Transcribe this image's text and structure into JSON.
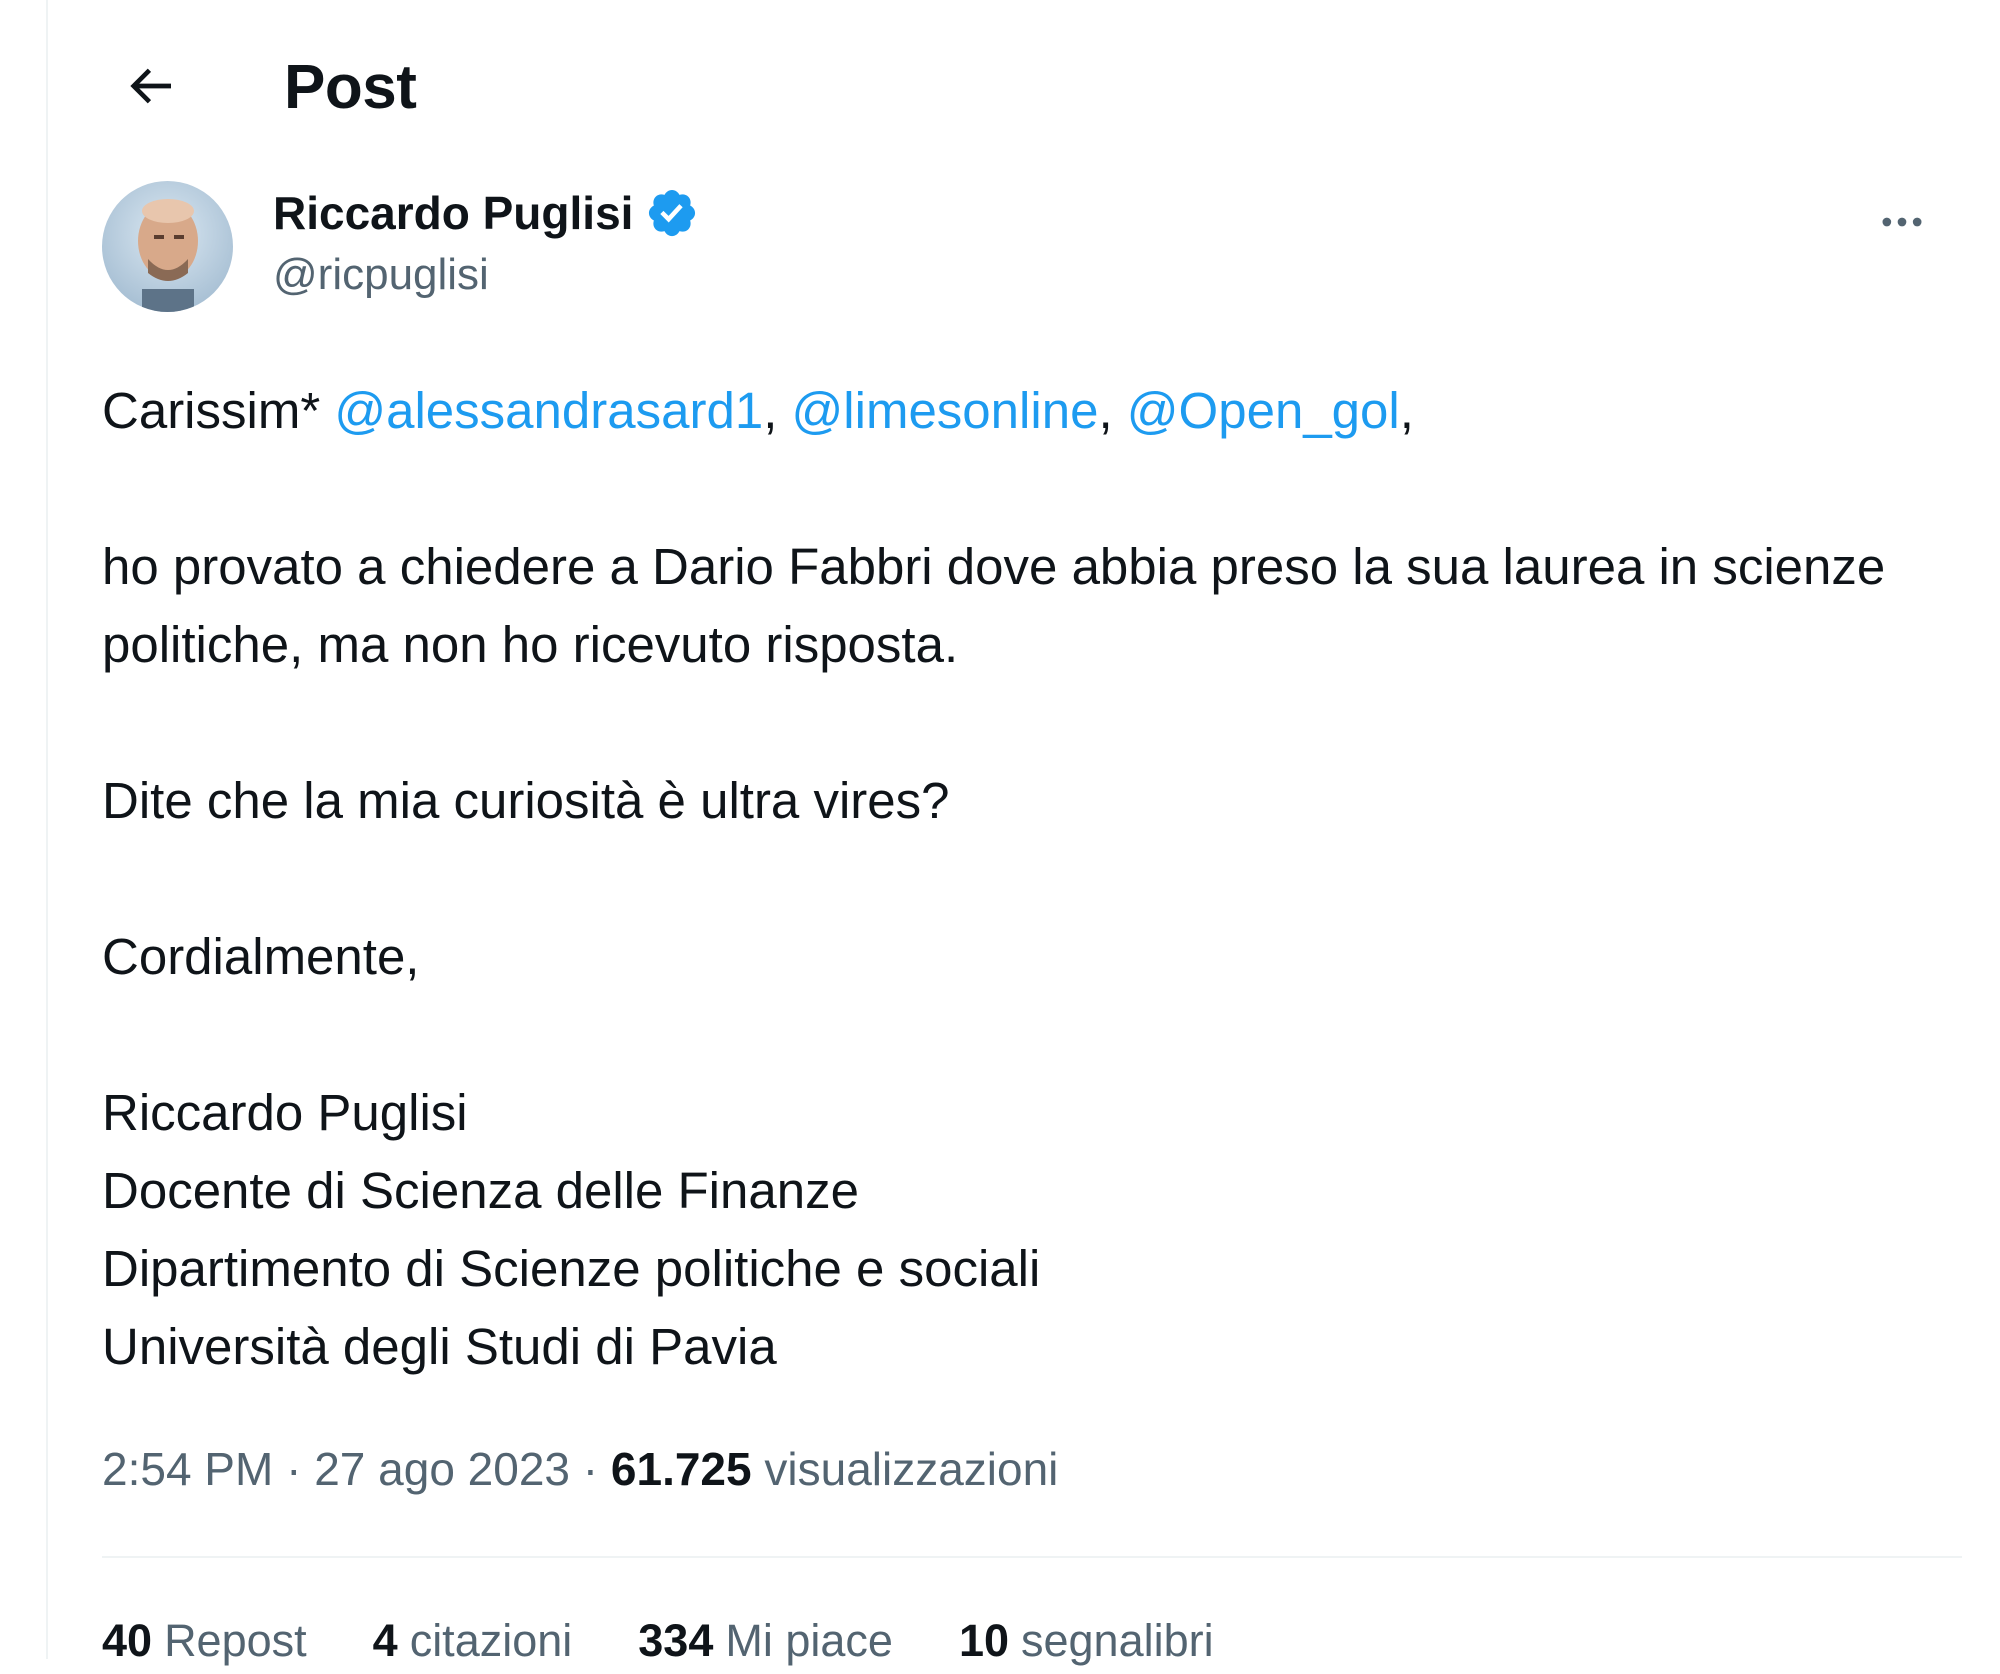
{
  "header": {
    "title": "Post",
    "back_icon": "arrow-left-icon"
  },
  "author": {
    "name": "Riccardo Puglisi",
    "handle": "@ricpuglisi",
    "verified": true,
    "verified_color": "#1d9bf0"
  },
  "tweet": {
    "greeting_prefix": "Carissim* ",
    "mentions": [
      "@alessandrasard1",
      "@limesonline",
      "@Open_gol"
    ],
    "separator": ", ",
    "greeting_suffix": ",",
    "paragraph_1": "ho provato a chiedere a Dario Fabbri dove abbia preso la sua laurea in scienze politiche, ma non ho ricevuto risposta.",
    "paragraph_2": "Dite che la mia curiosità è ultra vires?",
    "closing": "Cordialmente,",
    "signature": [
      "Riccardo Puglisi",
      "Docente di Scienza delle Finanze",
      "Dipartimento di Scienze politiche e sociali",
      "Università degli Studi di Pavia"
    ]
  },
  "meta": {
    "time": "2:54 PM",
    "dot": " · ",
    "date": "27 ago 2023",
    "views_count": "61.725",
    "views_label": "visualizzazioni"
  },
  "stats": [
    {
      "count": "40",
      "label": "Repost"
    },
    {
      "count": "4",
      "label": "citazioni"
    },
    {
      "count": "334",
      "label": "Mi piace"
    },
    {
      "count": "10",
      "label": "segnalibri"
    }
  ],
  "colors": {
    "link": "#1d9bf0",
    "secondary_text": "#536471",
    "primary_text": "#0f1419"
  }
}
